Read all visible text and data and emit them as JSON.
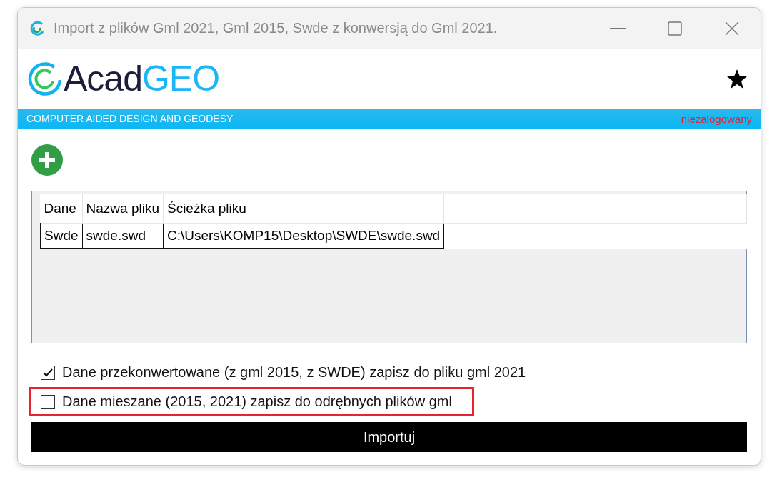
{
  "window": {
    "title": "Import z plików Gml 2021, Gml 2015, Swde z konwersją do Gml 2021."
  },
  "brand": {
    "logo_dark": "Acad",
    "logo_light": "GEO",
    "tagline": "COMPUTER AIDED DESIGN AND GEODESY",
    "login_status": "niezalogowany"
  },
  "table": {
    "columns": [
      "Dane",
      "Nazwa pliku",
      "Ścieżka pliku"
    ],
    "rows": [
      [
        "Swde",
        "swde.swd",
        "C:\\Users\\KOMP15\\Desktop\\SWDE\\swde.swd"
      ]
    ]
  },
  "options": [
    {
      "label": "Dane przekonwertowane (z gml 2015, z SWDE) zapisz do pliku gml 2021",
      "checked": true,
      "highlighted": false
    },
    {
      "label": "Dane mieszane (2015, 2021) zapisz do odrębnych plików gml",
      "checked": false,
      "highlighted": true
    }
  ],
  "button": "Importuj"
}
